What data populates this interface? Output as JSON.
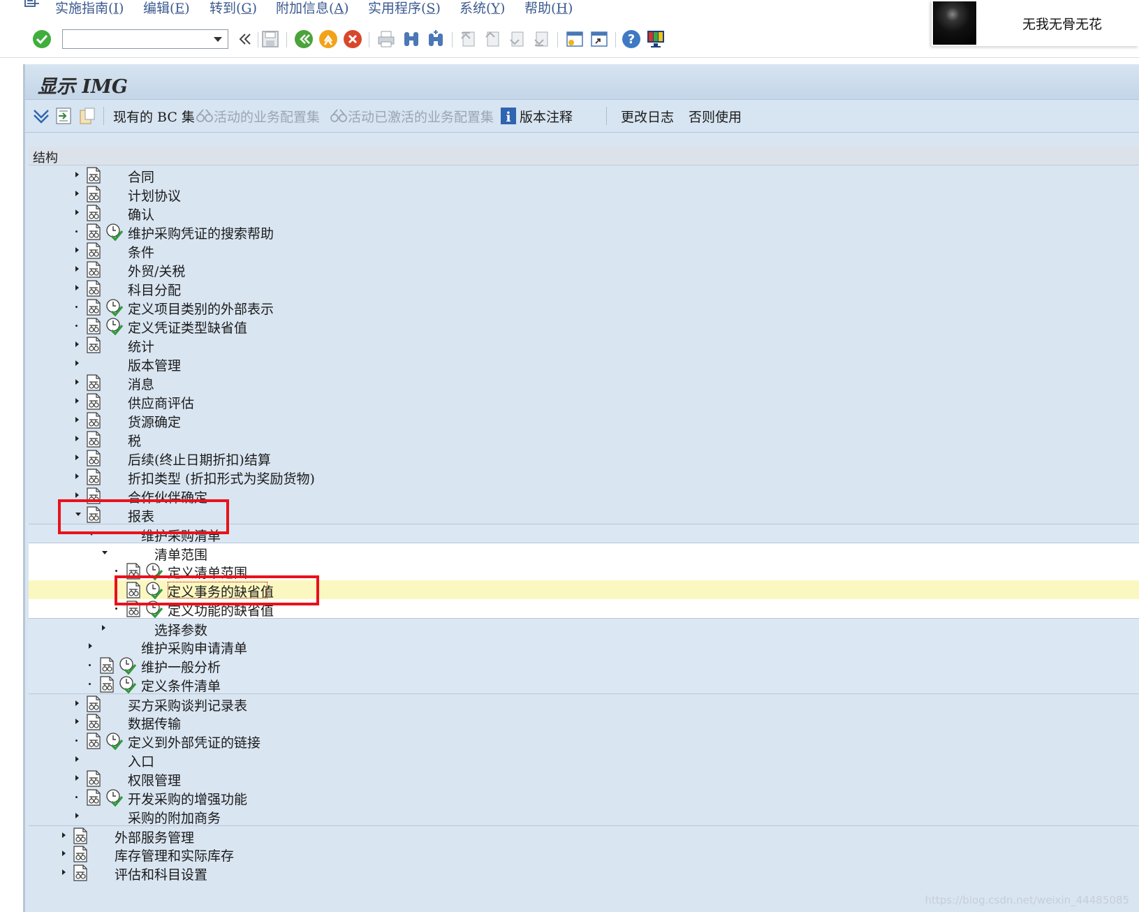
{
  "menu": [
    {
      "label": "实施指南(",
      "key": "I"
    },
    {
      "label": "编辑(",
      "key": "E"
    },
    {
      "label": "转到(",
      "key": "G"
    },
    {
      "label": "附加信息(",
      "key": "A"
    },
    {
      "label": "实用程序(",
      "key": "S"
    },
    {
      "label": "系统(",
      "key": "Y"
    },
    {
      "label": "帮助(",
      "key": "H"
    }
  ],
  "command_field": {
    "value": ""
  },
  "user": {
    "name": "无我无骨无花"
  },
  "page": {
    "title": "显示 IMG"
  },
  "app_toolbar": {
    "bc_sets": "现有的 BC 集",
    "active_bc": "活动的业务配置集",
    "activated_bc": "活动已激活的业务配置集",
    "release_notes": "版本注释",
    "change_log": "更改日志",
    "otherwise_use": "否则使用"
  },
  "tree": {
    "header": "结构",
    "rows": [
      {
        "label": "合同"
      },
      {
        "label": "计划协议"
      },
      {
        "label": "确认"
      },
      {
        "label": "维护采购凭证的搜索帮助"
      },
      {
        "label": "条件"
      },
      {
        "label": "外贸/关税"
      },
      {
        "label": "科目分配"
      },
      {
        "label": "定义项目类别的外部表示"
      },
      {
        "label": "定义凭证类型缺省值"
      },
      {
        "label": "统计"
      },
      {
        "label": "版本管理"
      },
      {
        "label": "消息"
      },
      {
        "label": "供应商评估"
      },
      {
        "label": "货源确定"
      },
      {
        "label": "税"
      },
      {
        "label": "后续(终止日期折扣)结算"
      },
      {
        "label": "折扣类型 (折扣形式为奖励货物)"
      },
      {
        "label": "合作伙伴确定"
      },
      {
        "label": "报表"
      },
      {
        "label": "维护采购清单"
      },
      {
        "label": "清单范围"
      },
      {
        "label": "定义清单范围"
      },
      {
        "label": "定义事务的缺省值"
      },
      {
        "label": "定义功能的缺省值"
      },
      {
        "label": "选择参数"
      },
      {
        "label": "维护采购申请清单"
      },
      {
        "label": "维护一般分析"
      },
      {
        "label": "定义条件清单"
      },
      {
        "label": "买方采购谈判记录表"
      },
      {
        "label": "数据传输"
      },
      {
        "label": "定义到外部凭证的链接"
      },
      {
        "label": "入口"
      },
      {
        "label": "权限管理"
      },
      {
        "label": "开发采购的增强功能"
      },
      {
        "label": "采购的附加商务"
      },
      {
        "label": "外部服务管理"
      },
      {
        "label": "库存管理和实际库存"
      },
      {
        "label": "评估和科目设置"
      }
    ]
  },
  "watermark": "https://blog.csdn.net/weixin_44485085",
  "colors": {
    "highlight": "#e8121a",
    "selected_row": "#fbf7c0",
    "tree_bg": "#d9e5f1",
    "menu_text": "#3a5a8f"
  }
}
